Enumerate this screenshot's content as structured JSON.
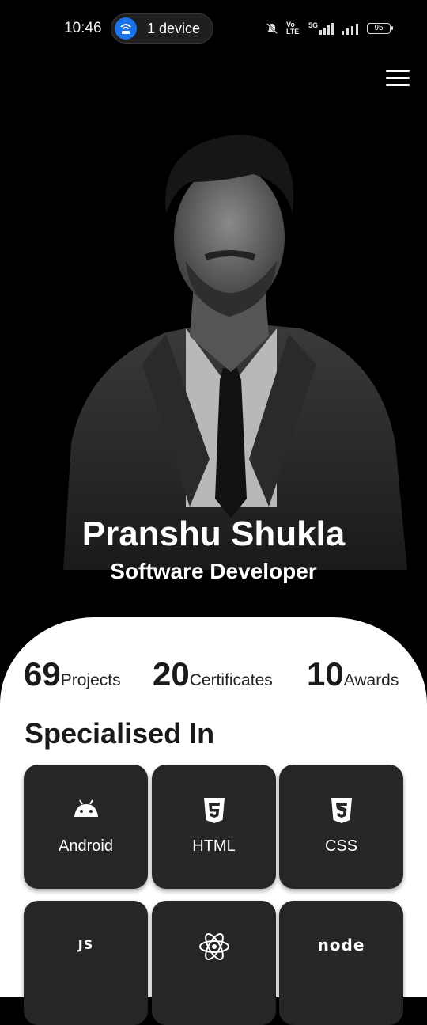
{
  "status_bar": {
    "time": "10:46",
    "hotspot_label": "1 device",
    "volte_label": "Vo LTE",
    "network_label": "5G",
    "battery": "95"
  },
  "profile": {
    "name": "Pranshu Shukla",
    "role": "Software Developer"
  },
  "stats": [
    {
      "value": "69",
      "label": "Projects"
    },
    {
      "value": "20",
      "label": "Certificates"
    },
    {
      "value": "10",
      "label": "Awards"
    }
  ],
  "specialised": {
    "title": "Specialised In",
    "items": [
      {
        "label": "Android",
        "icon": "android-icon"
      },
      {
        "label": "HTML",
        "icon": "html5-icon"
      },
      {
        "label": "CSS",
        "icon": "css3-icon"
      },
      {
        "label": "",
        "icon": "js-icon",
        "icon_text": "JS"
      },
      {
        "label": "",
        "icon": "react-icon"
      },
      {
        "label": "",
        "icon": "nodejs-icon",
        "icon_text": "node"
      }
    ]
  },
  "colors": {
    "background": "#000000",
    "sheet": "#ffffff",
    "card": "#262626",
    "hotspot_accent": "#1a73e8"
  }
}
